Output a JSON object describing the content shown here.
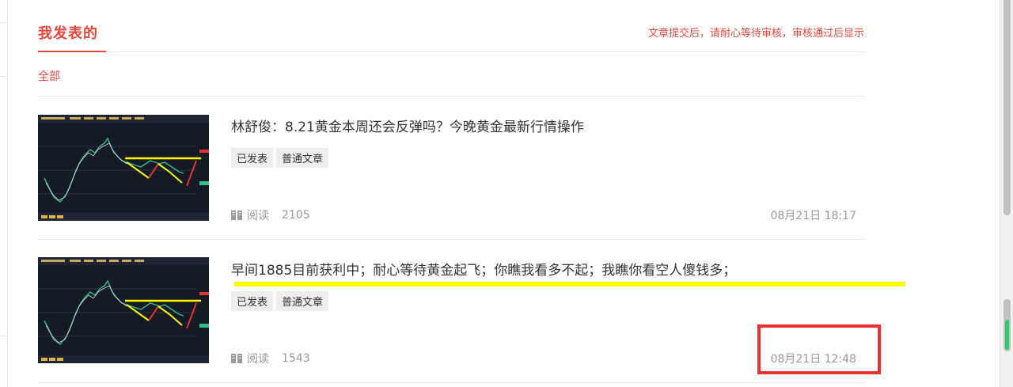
{
  "header": {
    "title": "我发表的",
    "notice": "文章提交后，请耐心等待审核，审核通过后显示"
  },
  "filter": {
    "all_label": "全部"
  },
  "articles": [
    {
      "title": "林舒俊：8.21黄金本周还会反弹吗？今晚黄金最新行情操作",
      "status_tag": "已发表",
      "type_tag": "普通文章",
      "read_label": "阅读",
      "read_count": "2105",
      "date": "08月21日 18:17"
    },
    {
      "title": "早间1885目前获利中；耐心等待黄金起飞；你瞧我看多不起；我瞧你看空人傻钱多；",
      "status_tag": "已发表",
      "type_tag": "普通文章",
      "read_label": "阅读",
      "read_count": "1543",
      "date": "08月21日 12:48"
    }
  ],
  "icons": {
    "read": "book-icon"
  },
  "colors": {
    "accent": "#e2483c",
    "highlight_yellow": "#ffff00",
    "highlight_red": "#e8312e",
    "chart_bg": "#151a25"
  }
}
